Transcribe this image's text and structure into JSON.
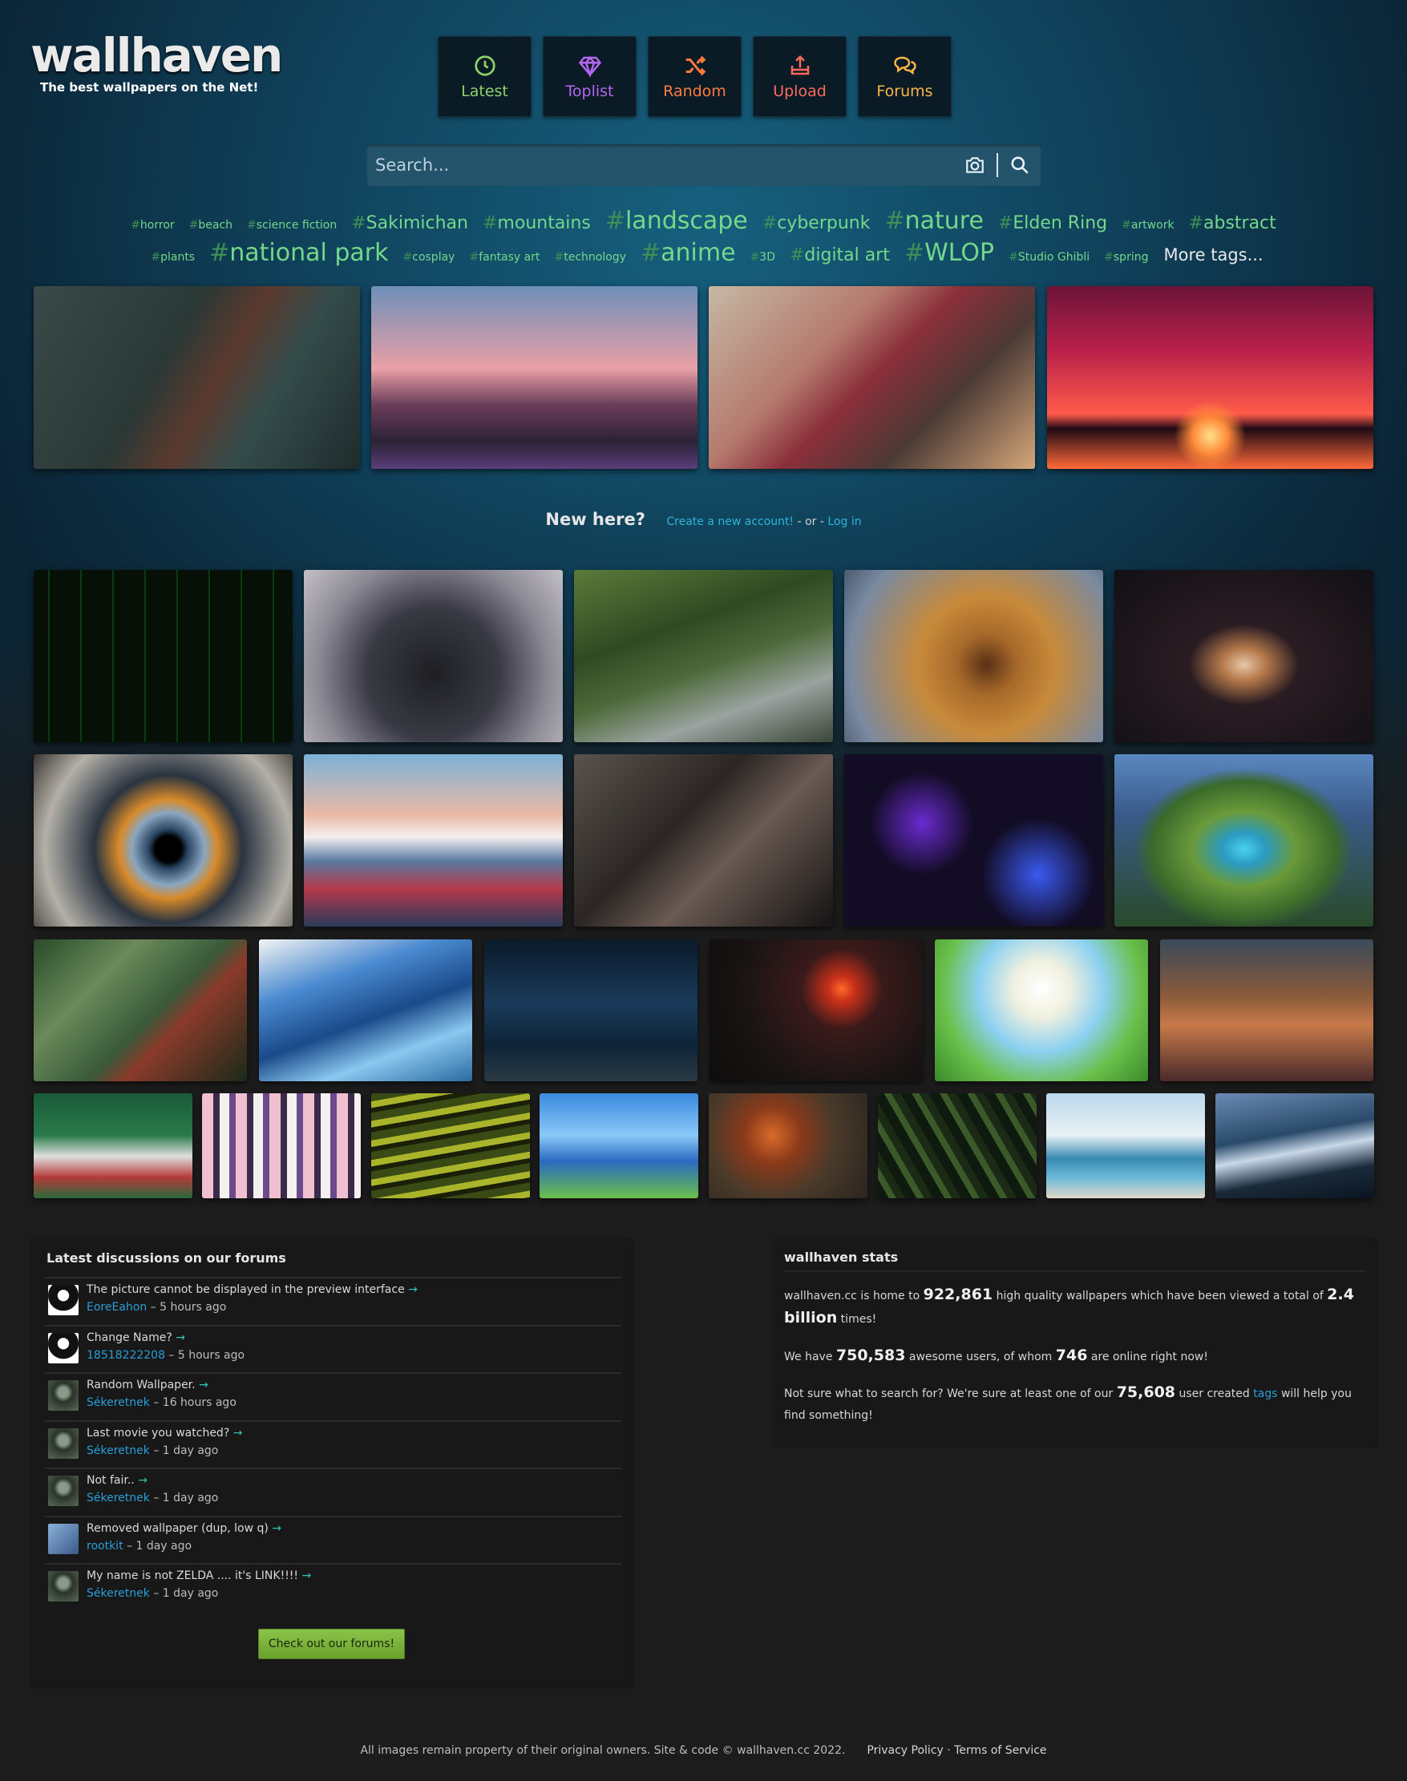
{
  "logo": {
    "name": "wallhaven",
    "tagline": "The best wallpapers on the Net!"
  },
  "nav": [
    {
      "label": "Latest",
      "icon": "clock-icon",
      "color": "#8ed26a"
    },
    {
      "label": "Toplist",
      "icon": "gem-icon",
      "color": "#b467f0"
    },
    {
      "label": "Random",
      "icon": "shuffle-icon",
      "color": "#ff7a3d"
    },
    {
      "label": "Upload",
      "icon": "upload-icon",
      "color": "#ff6a5f"
    },
    {
      "label": "Forums",
      "icon": "chat-icon",
      "color": "#ffb347"
    }
  ],
  "search": {
    "placeholder": "Search..."
  },
  "tags_row1": [
    {
      "label": "horror",
      "size": "s"
    },
    {
      "label": "beach",
      "size": "s"
    },
    {
      "label": "science fiction",
      "size": "s"
    },
    {
      "label": "Sakimichan",
      "size": "m"
    },
    {
      "label": "mountains",
      "size": "m"
    },
    {
      "label": "landscape",
      "size": "l"
    },
    {
      "label": "cyberpunk",
      "size": "m"
    },
    {
      "label": "nature",
      "size": "l"
    },
    {
      "label": "Elden Ring",
      "size": "m"
    },
    {
      "label": "artwork",
      "size": "s"
    },
    {
      "label": "abstract",
      "size": "m"
    }
  ],
  "tags_row2": [
    {
      "label": "plants",
      "size": "s"
    },
    {
      "label": "national park",
      "size": "l"
    },
    {
      "label": "cosplay",
      "size": "s"
    },
    {
      "label": "fantasy art",
      "size": "s"
    },
    {
      "label": "technology",
      "size": "s"
    },
    {
      "label": "anime",
      "size": "l"
    },
    {
      "label": "3D",
      "size": "s"
    },
    {
      "label": "digital art",
      "size": "m"
    },
    {
      "label": "WLOP",
      "size": "l"
    },
    {
      "label": "Studio Ghibli",
      "size": "s"
    },
    {
      "label": "spring",
      "size": "s"
    }
  ],
  "more_tags": "More tags...",
  "new_here": {
    "heading": "New here?",
    "create": "Create a new account!",
    "or": " - or - ",
    "login": "Log in"
  },
  "forum": {
    "title": "Latest discussions on our forums",
    "posts": [
      {
        "title": "The picture cannot be displayed in the preview interface",
        "user": "EoreEahon",
        "time": "5 hours ago"
      },
      {
        "title": "Change Name?",
        "user": "18518222208",
        "time": "5 hours ago"
      },
      {
        "title": "Random Wallpaper.",
        "user": "Sékeretnek",
        "time": "16 hours ago"
      },
      {
        "title": "Last movie you watched?",
        "user": "Sékeretnek",
        "time": "1 day ago"
      },
      {
        "title": "Not fair..",
        "user": "Sékeretnek",
        "time": "1 day ago"
      },
      {
        "title": "Removed wallpaper (dup, low q)",
        "user": "rootkit",
        "time": "1 day ago"
      },
      {
        "title": "My name is not ZELDA .... it's LINK!!!!",
        "user": "Sékeretnek",
        "time": "1 day ago"
      }
    ],
    "button": "Check out our forums!"
  },
  "stats": {
    "title": "wallhaven stats",
    "line1_a": "wallhaven.cc is home to ",
    "wallpapers": "922,861",
    "line1_b": " high quality wallpapers which have been viewed a total of ",
    "views": "2.4 billion",
    "line1_c": " times!",
    "line2_a": "We have ",
    "users": "750,583",
    "line2_b": " awesome users, of whom ",
    "online": "746",
    "line2_c": " are online right now!",
    "line3_a": "Not sure what to search for? We're sure at least one of our ",
    "tag_count": "75,608",
    "line3_b": " user created ",
    "tags_word": "tags",
    "line3_c": " will help you find something!"
  },
  "footer": {
    "text": "All images remain property of their original owners. Site & code © wallhaven.cc 2022.",
    "privacy": "Privacy Policy",
    "dot": " · ",
    "terms": "Terms of Service"
  }
}
